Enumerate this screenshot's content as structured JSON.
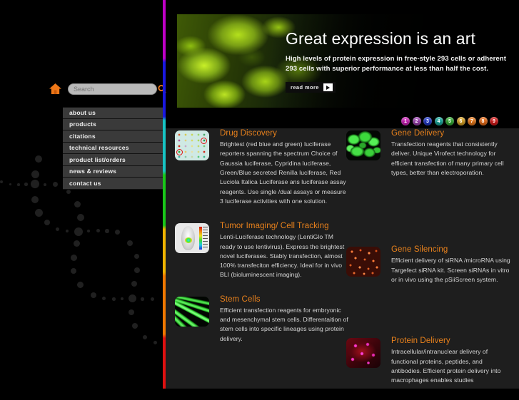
{
  "search": {
    "placeholder": "Search",
    "value": ""
  },
  "nav": {
    "items": [
      {
        "label": "about us"
      },
      {
        "label": "products"
      },
      {
        "label": "citations"
      },
      {
        "label": "technical resources"
      },
      {
        "label": "product list/orders"
      },
      {
        "label": "news & reviews"
      },
      {
        "label": "contact us"
      }
    ]
  },
  "banner": {
    "title": "Great expression is an art",
    "subtitle": "High levels of protein expression in free-style 293 cells or adherent 293 cells with superior performance at less than half the cost.",
    "cta_label": "read more"
  },
  "pager": {
    "dots": [
      {
        "label": "1",
        "color": "#cc1fb8"
      },
      {
        "label": "2",
        "color": "#9b3fb0"
      },
      {
        "label": "3",
        "color": "#1f36c8"
      },
      {
        "label": "4",
        "color": "#17a89c"
      },
      {
        "label": "5",
        "color": "#2fa82f"
      },
      {
        "label": "6",
        "color": "#d8a020"
      },
      {
        "label": "7",
        "color": "#e87818"
      },
      {
        "label": "8",
        "color": "#e86a14"
      },
      {
        "label": "9",
        "color": "#d41414"
      }
    ]
  },
  "cards": {
    "left": [
      {
        "title": "Drug Discovery",
        "desc": "Brightest (red blue and green) luciferase reporters spanning the spectrum Choice of Gaussia luciferase, Cypridina luciferase, Green/Blue secreted Renilla luciferase, Red Luciola Italica Luciferase ans luciferase assay reagents. Use single /dual assays or measure 3 luciferase activities with one solution.",
        "thumb": "microplate-wells-image"
      },
      {
        "title": "Tumor Imaging/ Cell Tracking",
        "desc": "Lenti-Luciferase technology (LentiGlo TM ready to use lentivirus). Express the brightest novel luciferases. Stably transfection, almost 100% transfeciton efficiency. Ideal for in vivo BLI (bioluminescent imaging).",
        "thumb": "mouse-bioluminescence-image"
      },
      {
        "title": "Stem Cells",
        "desc": "Efficient transfection reagents for embryonic and mesenchymal stem cells. Differentaition of stem cells into specific lineages using protein delivery.",
        "thumb": "green-fluorescent-cells-image"
      }
    ],
    "right": [
      {
        "title": "Gene Delivery",
        "desc": "Transfection reagents that consistently deliver. Unique Virofect technology for efficient transfection of many primary cell types, better than electroporation.",
        "thumb": "green-transfected-cells-image"
      },
      {
        "title": "Gene Silencing",
        "desc": "Efficient delivery of siRNA /microRNA using Targefect siRNA kit. Screen siRNAs in vitro or in vivo using the pSiiScreen system.",
        "thumb": "orange-sirna-cells-image"
      },
      {
        "title": "Protein Delivery",
        "desc": "Intracellular/intranuclear delivery of functional proteins, peptides, and antibodies. Efficient protein delivery into macrophages enables studies",
        "thumb": "red-protein-cells-image"
      }
    ]
  },
  "theme": {
    "accent_orange": "#e8811c",
    "content_bg": "#1e1e1e",
    "page_bg": "#000000",
    "nav_bg": "#3a3a3a"
  }
}
